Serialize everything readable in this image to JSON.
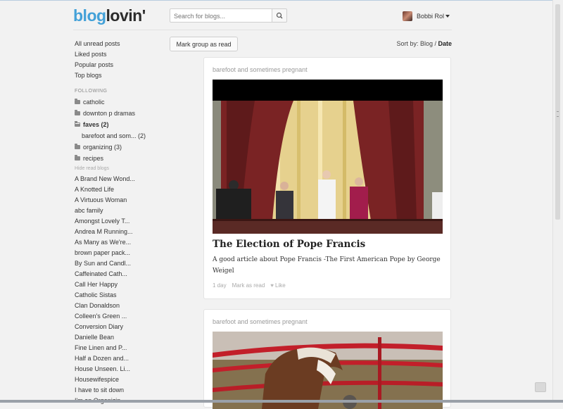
{
  "header": {
    "logo_blog": "blog",
    "logo_lovin": "lovin'",
    "search_placeholder": "Search for blogs...",
    "user_name": "Bobbi Rol"
  },
  "sidebar": {
    "links": [
      "All unread posts",
      "Liked posts",
      "Popular posts",
      "Top blogs"
    ],
    "following_label": "FOLLOWING",
    "folders_top": [
      "catholic",
      "downton p dramas"
    ],
    "faves_label": "faves (2)",
    "faves_sub": "barefoot and som... (2)",
    "folders_bottom": [
      "organizing (3)",
      "recipes"
    ],
    "hide_read": "Hide read blogs",
    "blogs": [
      "A Brand New Wond...",
      "A Knotted Life",
      "A Virtuous Woman",
      "abc family",
      "Amongst Lovely T...",
      "Andrea M Running...",
      "As Many as We're...",
      "brown paper pack...",
      "By Sun and Candl...",
      "Caffeinated Cath...",
      "Call Her Happy",
      "Catholic Sistas",
      "Clan Donaldson",
      "Colleen's Green ...",
      "Conversion Diary",
      "Danielle Bean",
      "Fine Linen and P...",
      "Half a Dozen and...",
      "House Unseen. Li...",
      "Housewifespice",
      "I have to sit down",
      "I'm an Organizin..."
    ]
  },
  "toolbar": {
    "mark_group": "Mark group as read",
    "sort_prefix": "Sort by: Blog / ",
    "sort_active": "Date"
  },
  "posts": [
    {
      "source": "barefoot and sometimes pregnant",
      "title": "The Election of Pope Francis",
      "description": "A good article about Pope Francis -The First American Pope by George Weigel",
      "age": "1 day",
      "mark_read": "Mark as read",
      "like": "Like"
    },
    {
      "source": "barefoot and sometimes pregnant"
    }
  ],
  "colors": {
    "brand_blue": "#43a1d8",
    "background": "#f2f2f2"
  }
}
